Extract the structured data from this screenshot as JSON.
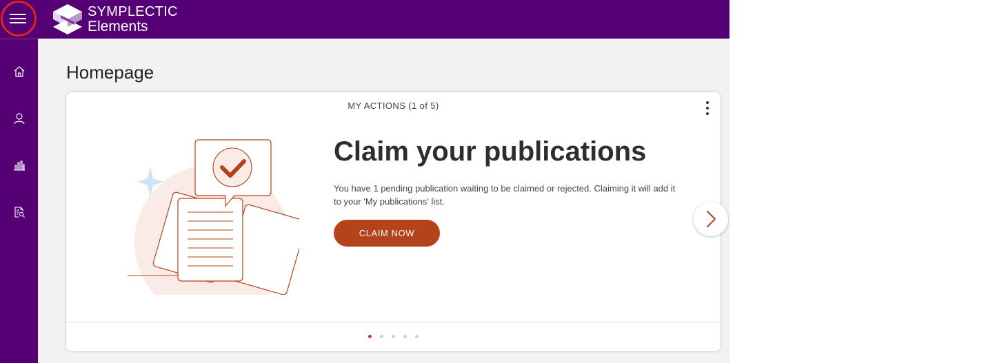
{
  "header": {
    "brand_name": "SYMPLECTIC",
    "product_name": "Elements",
    "menu_icon": "hamburger-menu-icon",
    "colors": {
      "header_bg": "#560075",
      "highlight_ring": "#e2231a"
    }
  },
  "sidebar": {
    "items": [
      {
        "name": "home",
        "icon": "home-icon"
      },
      {
        "name": "profile",
        "icon": "user-icon"
      },
      {
        "name": "reports",
        "icon": "bar-chart-icon"
      },
      {
        "name": "search-records",
        "icon": "document-search-icon"
      }
    ]
  },
  "main": {
    "page_title": "Homepage",
    "actions_card": {
      "header": "MY ACTIONS (1 of 5)",
      "headline": "Claim your publications",
      "description": "You have 1 pending publication waiting to be claimed or rejected. Claiming it will add it to your 'My publications' list.",
      "cta_label": "CLAIM NOW",
      "total_slides": 5,
      "active_slide": 1,
      "colors": {
        "accent": "#b5431a"
      }
    }
  }
}
